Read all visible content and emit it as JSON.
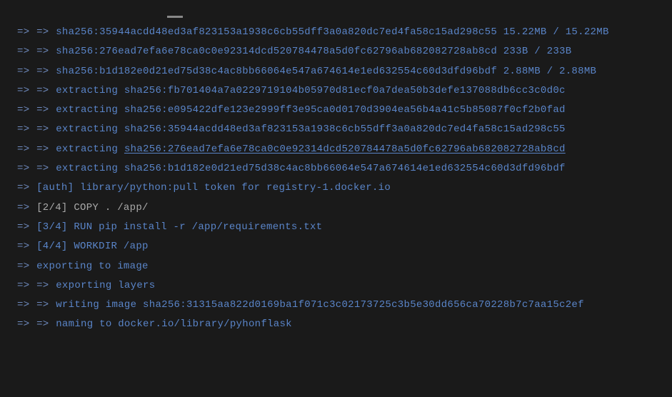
{
  "lines": [
    {
      "arrows": 2,
      "parts": [
        {
          "cls": "blue",
          "t": "sha256:35944acdd48ed3af823153a1938c6cb55dff3a0a820dc7ed4fa58c15ad298c55 15.22MB / 15.22MB"
        }
      ]
    },
    {
      "arrows": 2,
      "parts": [
        {
          "cls": "blue",
          "t": "sha256:276ead7efa6e78ca0c0e92314dcd520784478a5d0fc62796ab682082728ab8cd 233B / 233B"
        }
      ]
    },
    {
      "arrows": 2,
      "parts": [
        {
          "cls": "blue",
          "t": "sha256:b1d182e0d21ed75d38c4ac8bb66064e547a674614e1ed632554c60d3dfd96bdf 2.88MB / 2.88MB"
        }
      ]
    },
    {
      "arrows": 2,
      "parts": [
        {
          "cls": "blue",
          "t": "extracting sha256:fb701404a7a0229719104b05970d81ecf0a7dea50b3defe137088db6cc3c0d0c"
        }
      ]
    },
    {
      "arrows": 2,
      "parts": [
        {
          "cls": "blue",
          "t": "extracting sha256:e095422dfe123e2999ff3e95ca0d0170d3904ea56b4a41c5b85087f0cf2b0fad"
        }
      ]
    },
    {
      "arrows": 2,
      "parts": [
        {
          "cls": "blue",
          "t": "extracting sha256:35944acdd48ed3af823153a1938c6cb55dff3a0a820dc7ed4fa58c15ad298c55"
        }
      ]
    },
    {
      "arrows": 2,
      "parts": [
        {
          "cls": "blue",
          "t": "extracting "
        },
        {
          "cls": "blue underlined",
          "t": "sha256:276ead7efa6e78ca0c0e92314dcd520784478a5d0fc62796ab682082728ab8cd"
        }
      ]
    },
    {
      "arrows": 2,
      "parts": [
        {
          "cls": "blue",
          "t": "extracting sha256:b1d182e0d21ed75d38c4ac8bb66064e547a674614e1ed632554c60d3dfd96bdf"
        }
      ]
    },
    {
      "arrows": 1,
      "parts": [
        {
          "cls": "blue",
          "t": "[auth] library/python:pull token for registry-1.docker.io"
        }
      ]
    },
    {
      "arrows": 1,
      "parts": [
        {
          "cls": "gray",
          "t": "[2/4] COPY . /app/"
        }
      ]
    },
    {
      "arrows": 1,
      "parts": [
        {
          "cls": "blue",
          "t": "[3/4] RUN pip install -r /app/requirements.txt"
        }
      ]
    },
    {
      "arrows": 1,
      "parts": [
        {
          "cls": "blue",
          "t": "[4/4] WORKDIR /app"
        }
      ]
    },
    {
      "arrows": 1,
      "parts": [
        {
          "cls": "blue",
          "t": "exporting to image"
        }
      ]
    },
    {
      "arrows": 2,
      "parts": [
        {
          "cls": "blue",
          "t": "exporting layers"
        }
      ]
    },
    {
      "arrows": 2,
      "parts": [
        {
          "cls": "blue",
          "t": "writing image sha256:31315aa822d0169ba1f071c3c02173725c3b5e30dd656ca70228b7c7aa15c2ef"
        }
      ]
    },
    {
      "arrows": 2,
      "parts": [
        {
          "cls": "blue",
          "t": "naming to docker.io/library/pyhonflask"
        }
      ]
    }
  ],
  "arrow_glyph": "=>"
}
